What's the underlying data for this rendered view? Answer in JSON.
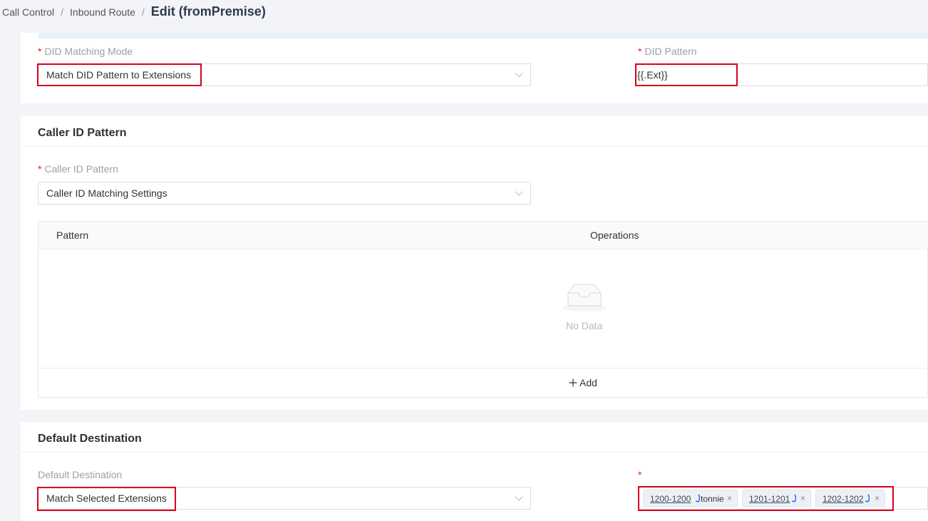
{
  "breadcrumb": {
    "items": [
      "Call Control",
      "Inbound Route"
    ],
    "separator": "/",
    "current": "Edit (fromPremise)"
  },
  "did": {
    "mode_label": "DID Matching Mode",
    "mode_value": "Match DID Pattern to Extensions",
    "pattern_label": "DID Pattern",
    "pattern_value": "{{.Ext}}"
  },
  "caller_id": {
    "section_title": "Caller ID Pattern",
    "label": "Caller ID Pattern",
    "value": "Caller ID Matching Settings",
    "table": {
      "columns": [
        "Pattern",
        "Operations"
      ],
      "empty_text": "No Data",
      "add_label": "Add"
    }
  },
  "default_destination": {
    "section_title": "Default Destination",
    "label": "Default Destination",
    "value": "Match Selected Extensions",
    "required_mark": "*",
    "tags": [
      {
        "number": "1200-1200",
        "name": "tonnie"
      },
      {
        "number": "1201-1201",
        "name": ""
      },
      {
        "number": "1202-1202",
        "name": ""
      }
    ]
  },
  "required_marker": "*",
  "colors": {
    "highlight": "#d9001b",
    "required": "#e02020",
    "phone_icon": "#1677ff"
  },
  "icons": [
    "chevron-down-icon",
    "empty-inbox-icon",
    "plus-icon",
    "phone-icon",
    "close-icon"
  ]
}
